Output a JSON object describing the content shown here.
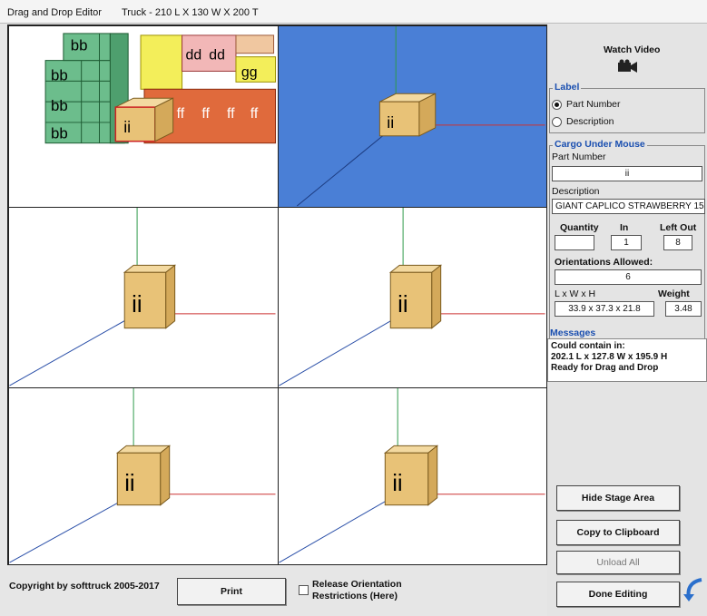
{
  "window": {
    "title": "Drag and Drop Editor",
    "truck": "Truck - 210 L X 130 W X 200 T"
  },
  "views": {
    "box_label": "ii",
    "stack_labels": [
      "bb",
      "bb",
      "bb",
      "bb",
      "dd",
      "dd",
      "gg",
      "ff",
      "ff",
      "ff",
      "ff",
      "ff"
    ]
  },
  "side": {
    "watch_video": "Watch Video",
    "label_group": "Label",
    "label_options": [
      "Part Number",
      "Description"
    ],
    "cargo_group": "Cargo Under Mouse",
    "part_number_label": "Part Number",
    "part_number_value": "ii",
    "description_label": "Description",
    "description_value": "GIANT CAPLICO STRAWBERRY 15",
    "quantity_label": "Quantity",
    "quantity_value": "",
    "in_label": "In",
    "in_value": "1",
    "left_out_label": "Left Out",
    "left_out_value": "8",
    "orientations_label": "Orientations Allowed:",
    "orientations_value": "6",
    "lwh_label": "L x W x H",
    "lwh_value": "33.9 x 37.3 x 21.8",
    "weight_label": "Weight",
    "weight_value": "3.48",
    "messages_label": "Messages",
    "messages": [
      "Could contain in:",
      "202.1 L x 127.8 W x 195.9 H",
      "Ready for Drag and Drop"
    ],
    "buttons": {
      "hide_stage": "Hide Stage Area",
      "copy": "Copy to Clipboard",
      "unload": "Unload All",
      "done": "Done Editing"
    }
  },
  "footer": {
    "copyright": "Copyright by softtruck 2005-2017",
    "print": "Print",
    "release_line1": "Release Orientation",
    "release_line2": "Restrictions (Here)"
  },
  "colors": {
    "box": "#e8c277",
    "stage_blue": "#4a7fd6",
    "axis_red": "#cc3333",
    "axis_green": "#2e9a4a",
    "axis_blue": "#2a4fa8"
  }
}
